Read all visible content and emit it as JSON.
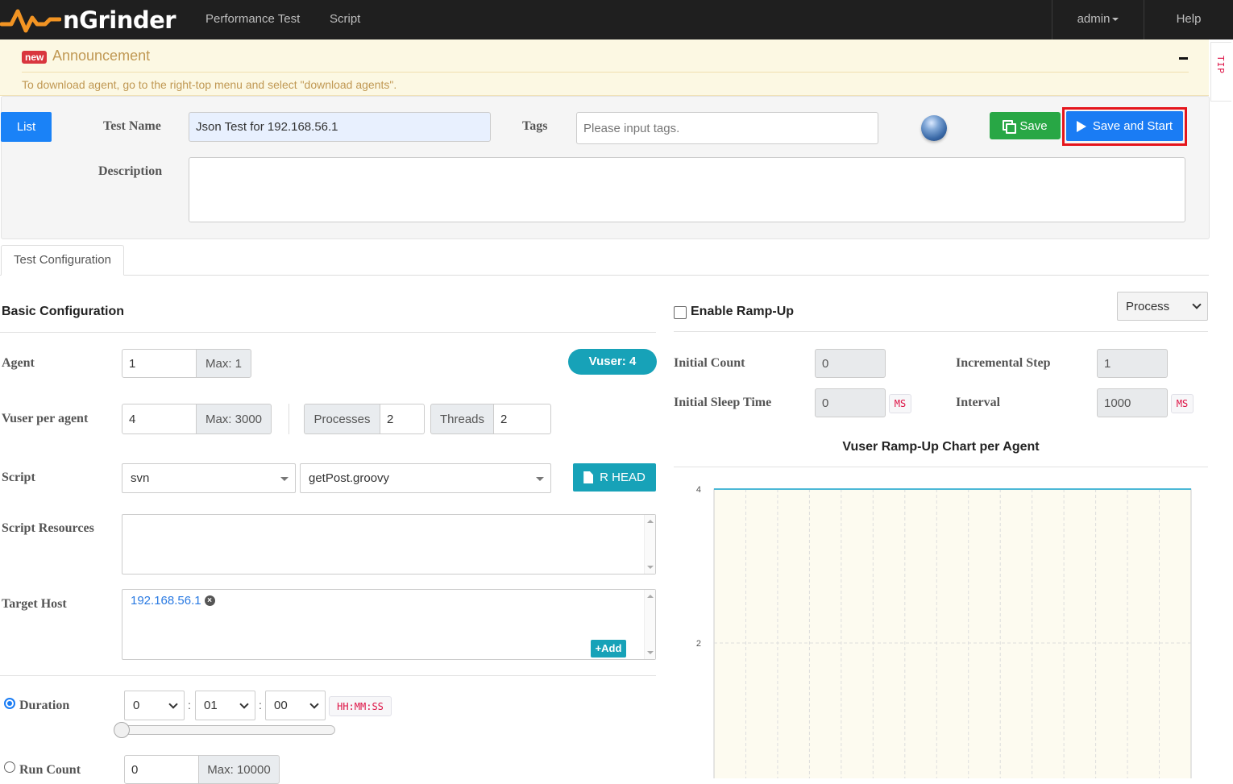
{
  "navbar": {
    "brand": "nGrinder",
    "links": [
      "Performance Test",
      "Script"
    ],
    "user": "admin",
    "help": "Help"
  },
  "announcement": {
    "badge": "new",
    "title": "Announcement",
    "message": "To download agent, go to the right-top menu and select \"download agents\".",
    "collapse_symbol": "−",
    "tip_label": "TIP"
  },
  "header": {
    "list_button": "List",
    "test_name_label": "Test Name",
    "test_name_value": "Json Test for 192.168.56.1",
    "tags_label": "Tags",
    "tags_placeholder": "Please input tags.",
    "description_label": "Description",
    "save_button": "Save",
    "save_start_button": "Save and Start"
  },
  "tabs": [
    "Test Configuration"
  ],
  "basic": {
    "title": "Basic Configuration",
    "agent_label": "Agent",
    "agent_value": "1",
    "agent_max": "Max: 1",
    "vuser_badge": "Vuser: 4",
    "vuser_label": "Vuser per agent",
    "vuser_value": "4",
    "vuser_max": "Max: 3000",
    "processes_label": "Processes",
    "processes_value": "2",
    "threads_label": "Threads",
    "threads_value": "2",
    "script_label": "Script",
    "script_repo": "svn",
    "script_file": "getPost.groovy",
    "rhead_button": "R HEAD",
    "resources_label": "Script Resources",
    "target_label": "Target Host",
    "target_host": "192.168.56.1",
    "add_button": "+Add",
    "duration_label": "Duration",
    "duration_h": "0",
    "duration_m": "01",
    "duration_s": "00",
    "duration_unit": "HH:MM:SS",
    "duration_slider_fraction": 0,
    "runcount_label": "Run Count",
    "runcount_value": "0",
    "runcount_max": "Max: 10000"
  },
  "rampup": {
    "enable_label": "Enable Ramp-Up",
    "enabled": false,
    "type_select": "Process",
    "initial_count_label": "Initial Count",
    "initial_count": "0",
    "incremental_step_label": "Incremental Step",
    "incremental_step": "1",
    "initial_sleep_label": "Initial Sleep Time",
    "initial_sleep": "0",
    "interval_label": "Interval",
    "interval": "1000",
    "ms_unit": "MS"
  },
  "chart_data": {
    "type": "line",
    "title": "Vuser Ramp-Up Chart per Agent",
    "xlabel": "",
    "ylabel": "",
    "y_ticks": [
      4,
      2
    ],
    "ylim": [
      0,
      4
    ],
    "x_gridlines": 15,
    "grid": true,
    "series": [
      {
        "values": [
          4,
          4,
          4,
          4,
          4,
          4,
          4,
          4,
          4,
          4,
          4,
          4,
          4,
          4,
          4,
          4
        ]
      }
    ],
    "colors": {
      "line": "#4bb8d6",
      "plot_bg": "#fdfbf0"
    }
  },
  "colors": {
    "primary": "#1a7cf4",
    "success": "#28a745",
    "info": "#17a2b8",
    "highlight": "#e5151c"
  }
}
